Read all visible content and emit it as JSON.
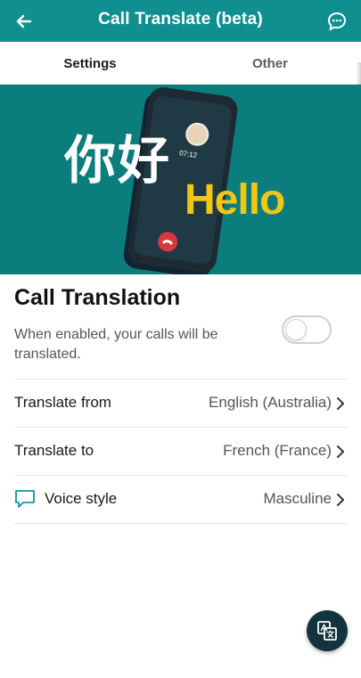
{
  "appbar": {
    "title": "Call Translate (beta)",
    "back_icon": "arrow-left-icon",
    "feedback_icon": "chat-bubble-dots-icon",
    "color": "#0f8f8f"
  },
  "tabs": [
    {
      "label": "Settings",
      "selected": true
    },
    {
      "label": "Other",
      "selected": false
    }
  ],
  "hero": {
    "greeting_chinese": "你好",
    "greeting_english": "Hello",
    "call_timer": "07:12",
    "background_color": "#0b7d7d",
    "accent_color": "#f2c617"
  },
  "call_translation": {
    "title": "Call Translation",
    "description": "When enabled, your calls will be translated.",
    "enabled": false
  },
  "settings": [
    {
      "label": "Translate from",
      "value": "English (Australia)"
    },
    {
      "label": "Translate to",
      "value": "French (France)"
    },
    {
      "label": "Voice style",
      "value": "Masculine",
      "icon": "speech-bubble-icon"
    }
  ],
  "fab": {
    "icon": "translate-icon"
  }
}
